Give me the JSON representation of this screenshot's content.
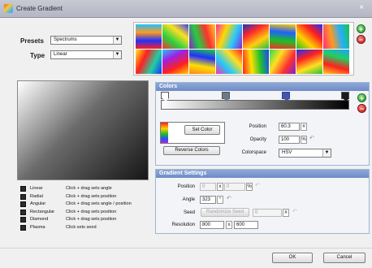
{
  "window": {
    "title": "Create Gradient",
    "close_glyph": "×"
  },
  "presets": {
    "label": "Presets",
    "value": "Spectrums"
  },
  "type_select": {
    "label": "Type",
    "value": "Linear"
  },
  "swatches": [
    [
      "#ff1e1e",
      "#2030ff",
      "#ff9a20",
      "#1ec0ff"
    ],
    [
      "#ff3030",
      "#2ad040",
      "#ffe020",
      "#3040ff"
    ],
    [
      "#8a20c8",
      "#20d040",
      "#ff3030",
      "#ffd020"
    ],
    [
      "#ff2aa0",
      "#ffd800",
      "#26c8ff",
      "#9020d0"
    ],
    [
      "#1830c0",
      "#ff2a2a",
      "#ffcf10",
      "#18c040"
    ],
    [
      "#ff2a2a",
      "#1ec020",
      "#2060ff",
      "#ffcc00"
    ],
    [
      "#26c020",
      "#ffd200",
      "#ff1e1e",
      "#1a30ff"
    ],
    [
      "#ff2a80",
      "#ff9a20",
      "#20b0ff",
      "#1ec040"
    ],
    [
      "#ffee20",
      "#ff2020",
      "#20d0a0",
      "#1a30ff"
    ],
    [
      "#20c8ff",
      "#a020e0",
      "#ff2020",
      "#ffd000"
    ],
    [
      "#ff8020",
      "#ffe000",
      "#2030ff",
      "#20d040"
    ],
    [
      "#ff30a0",
      "#20c8ff",
      "#ffe020",
      "#ff2020"
    ],
    [
      "#ff2020",
      "#ffe000",
      "#1ec030",
      "#2040ff"
    ],
    [
      "#20e050",
      "#ffe020",
      "#ff3030",
      "#8020d0"
    ],
    [
      "#1830ff",
      "#ff2020",
      "#ffe020",
      "#20c040"
    ],
    [
      "#ffd020",
      "#ff2020",
      "#20d060",
      "#20a0ff"
    ]
  ],
  "swatch_add_glyph": "+",
  "swatch_remove_glyph": "−",
  "colors_panel": {
    "title": "Colors",
    "set_color": "Set Color",
    "reverse_colors": "Reverse Colors",
    "position_label": "Position",
    "position_value": "60.3",
    "position_unit": "#",
    "opacity_label": "Opacity",
    "opacity_value": "100",
    "opacity_unit": "%",
    "colorspace_label": "Colorspace",
    "colorspace_value": "HSV",
    "add_glyph": "+",
    "remove_glyph": "−",
    "stops": [
      {
        "offset": 0.0,
        "color": "#ffffff",
        "selected": false
      },
      {
        "offset": 0.34,
        "color": "#6b7a88",
        "selected": false
      },
      {
        "offset": 0.67,
        "color": "#4a55a0",
        "selected": true
      },
      {
        "offset": 1.0,
        "color": "#1a1a1a",
        "selected": false
      }
    ]
  },
  "gradient_settings": {
    "title": "Gradient Settings",
    "position_label": "Position",
    "position_x": "0",
    "position_y": "0",
    "position_sep": "x",
    "position_unit": "%",
    "angle_label": "Angle",
    "angle_value": "323",
    "angle_unit": "°",
    "seed_label": "Seed",
    "randomize_label": "Randomize Seed",
    "seed_value": "0",
    "seed_unit": "#",
    "resolution_label": "Resolution",
    "resolution_w": "800",
    "resolution_sep": "x",
    "resolution_h": "600",
    "reset_glyph": "↶"
  },
  "legend": [
    {
      "name": "Linear",
      "desc": "Click + drag sets angle"
    },
    {
      "name": "Radial",
      "desc": "Click + drag sets position"
    },
    {
      "name": "Angular",
      "desc": "Click + drag sets angle / position"
    },
    {
      "name": "Rectangular",
      "desc": "Click + drag sets position"
    },
    {
      "name": "Diamond",
      "desc": "Click + drag sets position"
    },
    {
      "name": "Plasma",
      "desc": "Click sets seed"
    }
  ],
  "footer": {
    "ok": "OK",
    "cancel": "Cancel"
  }
}
